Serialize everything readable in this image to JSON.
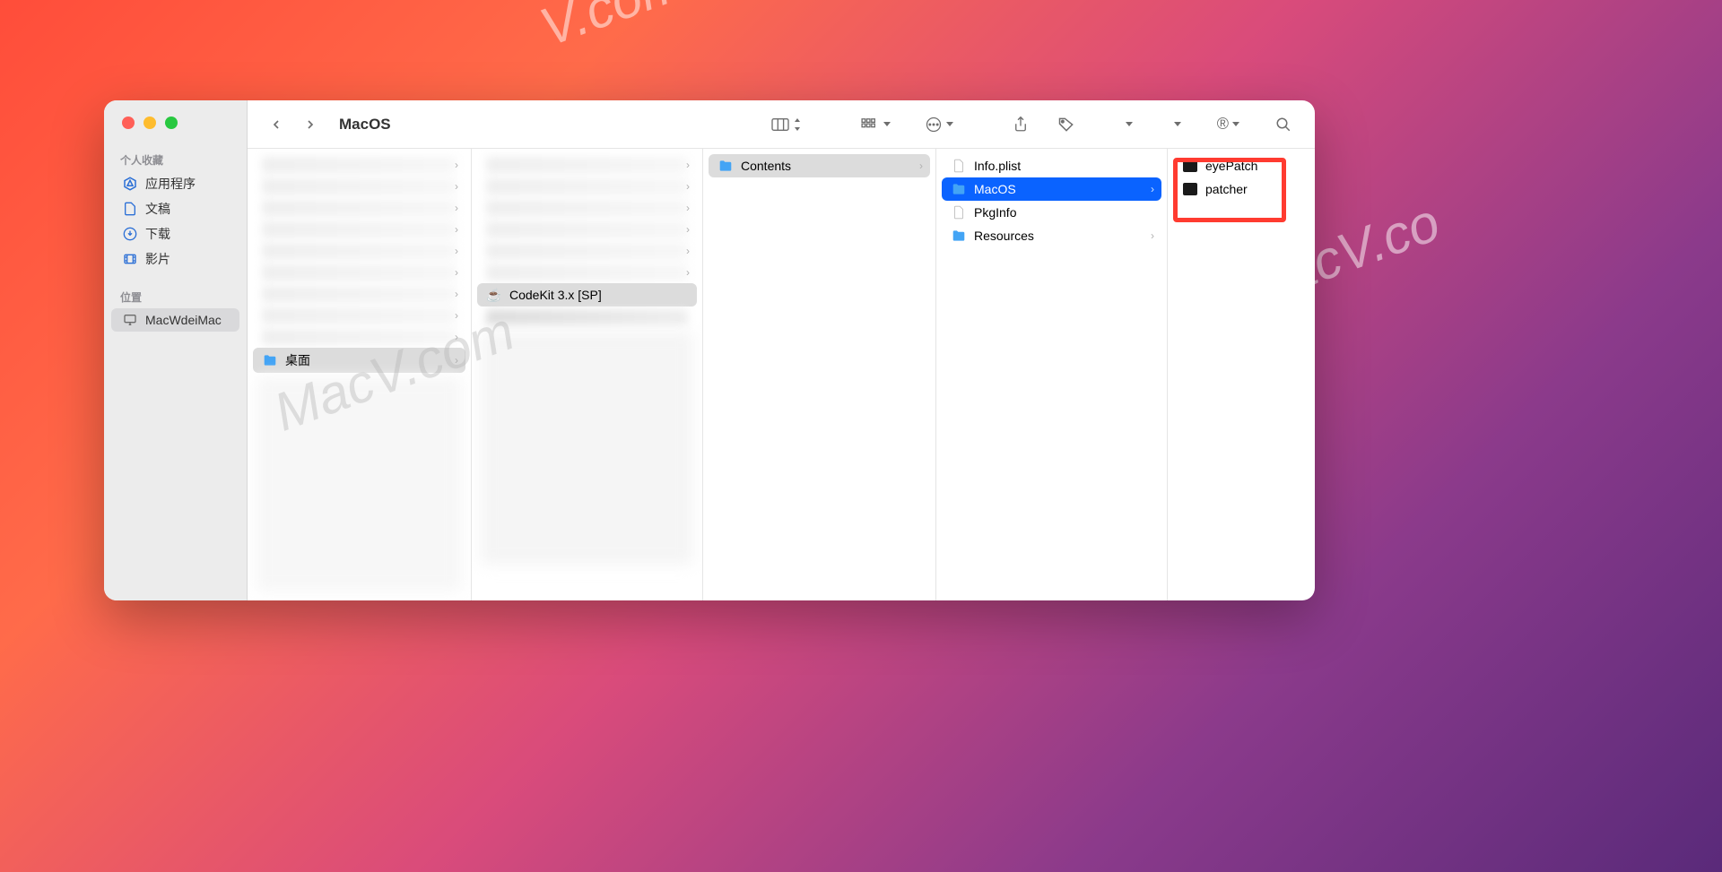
{
  "window_title": "MacOS",
  "sidebar": {
    "sections": [
      {
        "title": "个人收藏",
        "items": [
          {
            "label": "应用程序",
            "icon": "app-store"
          },
          {
            "label": "文稿",
            "icon": "document"
          },
          {
            "label": "下载",
            "icon": "download"
          },
          {
            "label": "影片",
            "icon": "movie"
          }
        ]
      },
      {
        "title": "位置",
        "items": [
          {
            "label": "MacWdeiMac",
            "icon": "imac",
            "selected": true
          }
        ]
      }
    ]
  },
  "columns": {
    "col1": {
      "selected_item": {
        "label": "桌面",
        "icon": "folder"
      }
    },
    "col2": {
      "selected_item": {
        "label": "CodeKit 3.x [SP]",
        "icon": "java"
      },
      "blurred_item_below": "codekit_macwn.dmg"
    },
    "col3": {
      "items": [
        {
          "label": "Contents",
          "icon": "folder",
          "has_children": true,
          "selected": true
        }
      ]
    },
    "col4": {
      "items": [
        {
          "label": "Info.plist",
          "icon": "doc",
          "has_children": false
        },
        {
          "label": "MacOS",
          "icon": "folder",
          "has_children": true,
          "selected": true
        },
        {
          "label": "PkgInfo",
          "icon": "doc",
          "has_children": false
        },
        {
          "label": "Resources",
          "icon": "folder",
          "has_children": true
        }
      ]
    },
    "col5": {
      "items": [
        {
          "label": "eyePatch",
          "icon": "exec"
        },
        {
          "label": "patcher",
          "icon": "exec"
        }
      ]
    }
  },
  "watermarks": [
    "V.com",
    "MacV.com",
    "MacV.co"
  ]
}
